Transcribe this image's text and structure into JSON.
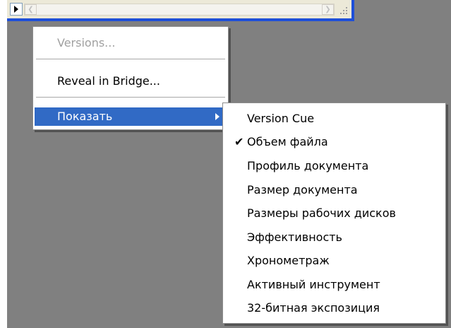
{
  "main_menu": {
    "items": [
      {
        "label": "Versions...",
        "disabled": true
      },
      {
        "label": "Reveal in Bridge...",
        "disabled": false
      },
      {
        "label": "Показать",
        "highlighted": true,
        "has_submenu": true
      }
    ]
  },
  "submenu": {
    "items": [
      {
        "label": "Version Cue",
        "checked": false
      },
      {
        "label": "Объем файла",
        "checked": true
      },
      {
        "label": "Профиль документа",
        "checked": false
      },
      {
        "label": "Размер документа",
        "checked": false
      },
      {
        "label": "Размеры рабочих дисков",
        "checked": false
      },
      {
        "label": "Эффективность",
        "checked": false
      },
      {
        "label": "Хронометраж",
        "checked": false
      },
      {
        "label": "Активный инструмент",
        "checked": false
      },
      {
        "label": "32-битная экспозиция",
        "checked": false
      }
    ],
    "check_glyph": "✔"
  },
  "colors": {
    "workspace": "#808080",
    "highlight": "#316ac5",
    "statusbar_border": "#1e4fd8"
  }
}
